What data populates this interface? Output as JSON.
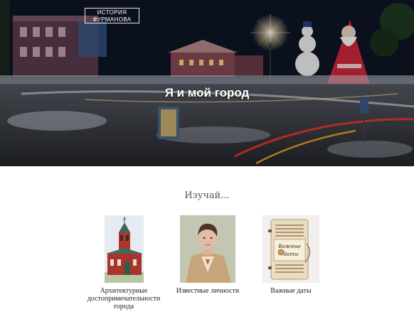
{
  "header": {
    "logo_line1": "ИСТОРИЯ",
    "logo_line2": "ФУРМАНОВА",
    "hero_title": "Я и мой город"
  },
  "main": {
    "section_title": "Изучай...",
    "cards": [
      {
        "label": "Архитектурные достопримечательности города",
        "icon": "church-photo"
      },
      {
        "label": "Известные личности",
        "icon": "portrait-painting"
      },
      {
        "label": "Важные даты",
        "icon": "notebook-photo",
        "image_text": "Важные даты"
      }
    ]
  },
  "colors": {
    "hero_overlay": "#1c2030",
    "title_text": "#ffffff",
    "section_title": "#555555",
    "caption_text": "#222222"
  }
}
